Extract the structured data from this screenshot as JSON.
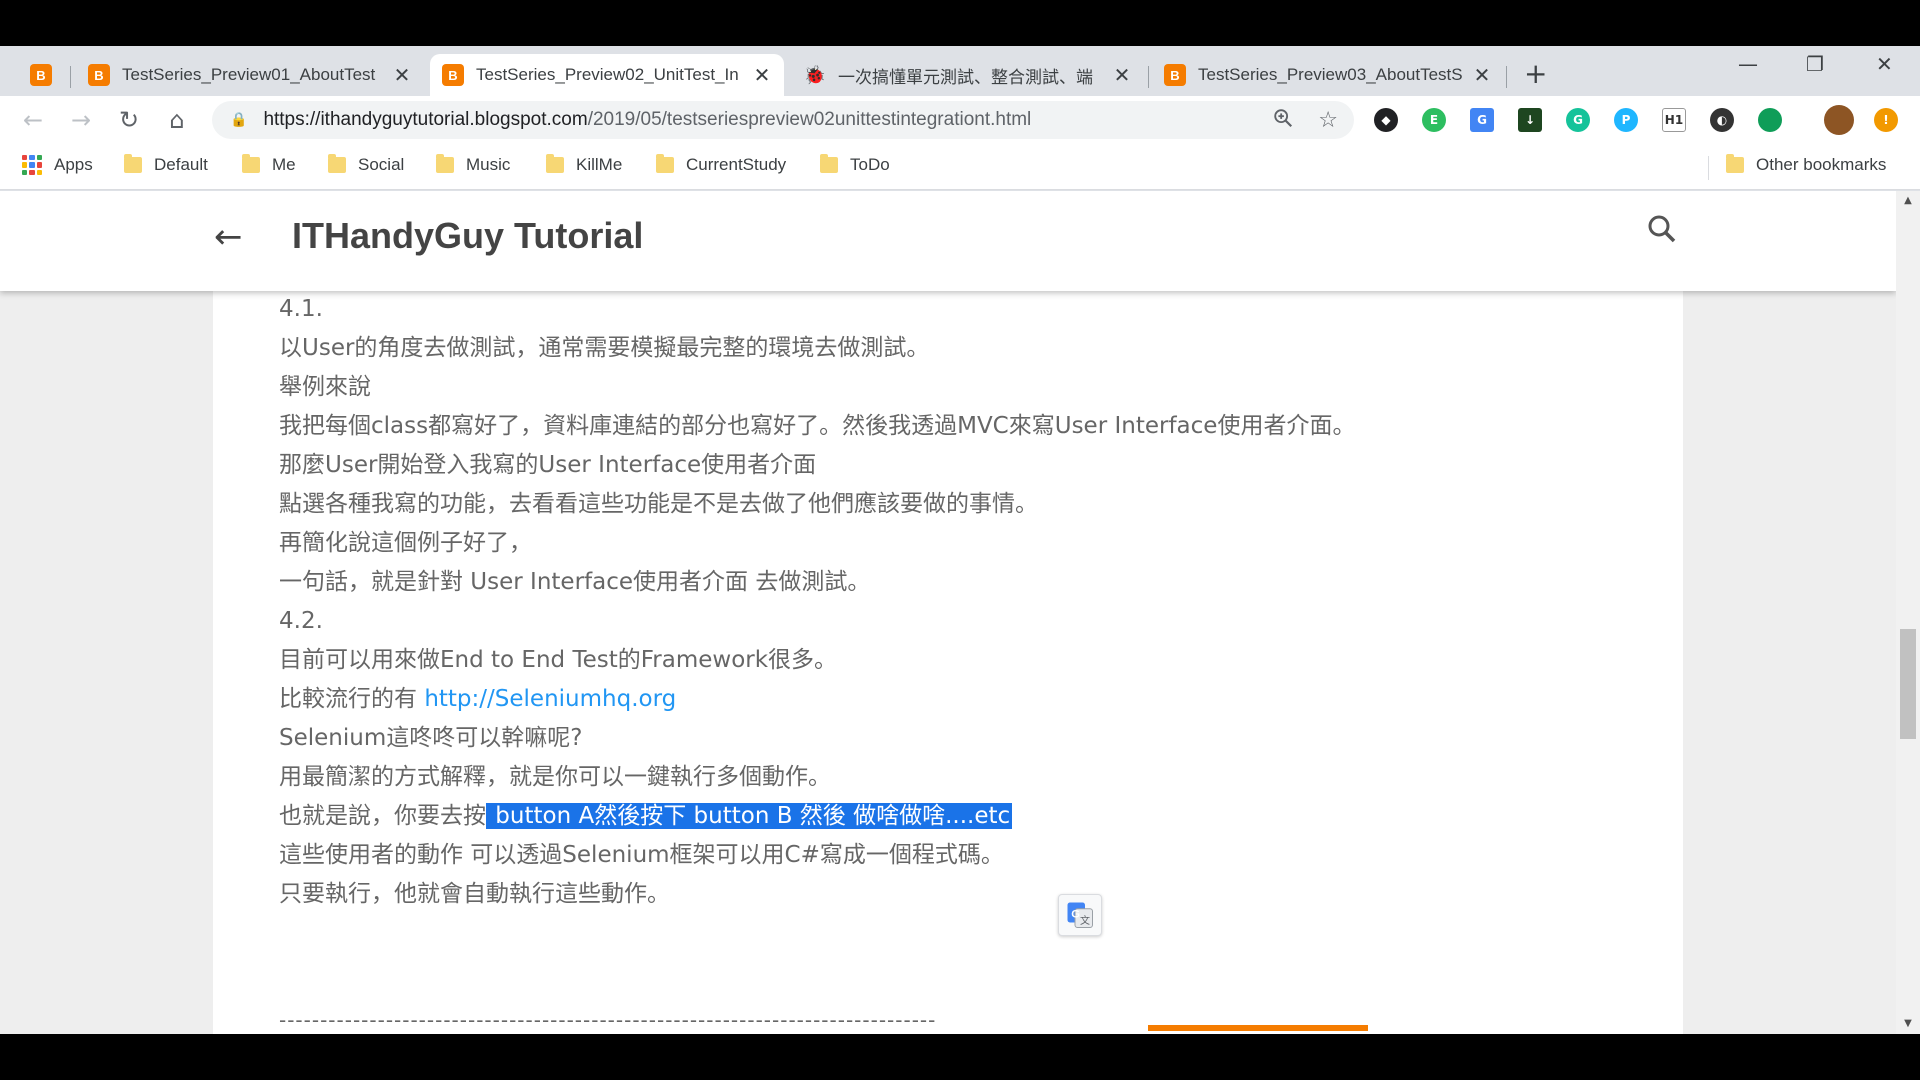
{
  "tabs": [
    {
      "title": "TestSeries_Preview01_AboutTest",
      "favicon": "blogger-icon",
      "active": false
    },
    {
      "title": "TestSeries_Preview02_UnitTest_In",
      "favicon": "blogger-icon",
      "active": true
    },
    {
      "title": "一次搞懂單元測試、整合測試、端",
      "favicon": "bug-icon",
      "active": false
    },
    {
      "title": "TestSeries_Preview03_AboutTestS",
      "favicon": "blogger-icon",
      "active": false
    }
  ],
  "address_bar": {
    "host": "https://ithandyguytutorial.blogspot.com",
    "path": "/2019/05/testseriespreview02unittestintegrationt.html"
  },
  "bookmarks": {
    "apps": "Apps",
    "items": [
      "Default",
      "Me",
      "Social",
      "Music",
      "KillMe",
      "CurrentStudy",
      "ToDo"
    ],
    "other": "Other bookmarks"
  },
  "blog": {
    "title": "ITHandyGuy Tutorial"
  },
  "content": {
    "l01": "4.1.",
    "l02": "以User的角度去做測試，通常需要模擬最完整的環境去做測試。",
    "l03": "舉例來說",
    "l04": "我把每個class都寫好了，資料庫連結的部分也寫好了。然後我透過MVC來寫User Interface使用者介面。",
    "l05": "那麼User開始登入我寫的User Interface使用者介面",
    "l06": "點選各種我寫的功能，去看看這些功能是不是去做了他們應該要做的事情。",
    "l07": "再簡化說這個例子好了，",
    "l08": "一句話，就是針對 User Interface使用者介面 去做測試。",
    "l09": "4.2.",
    "l10": "目前可以用來做End to End Test的Framework很多。",
    "l11_prefix": "比較流行的有 ",
    "l11_link": "http://Seleniumhq.org",
    "l12": "Selenium這咚咚可以幹嘛呢?",
    "l13": "用最簡潔的方式解釋，就是你可以一鍵執行多個動作。",
    "l14_prefix": "也就是說，你要去按",
    "l14_selected": " button A然後按下 button B 然後 做啥做啥....etc",
    "l15": "這些使用者的動作 可以透過Selenium框架可以用C#寫成一個程式碼。",
    "l16": "只要執行，他就會自動執行這些動作。",
    "divider": "--------------------------------------------------------------------------------"
  },
  "colors": {
    "selection": "#1a73e8",
    "link": "#2196f3",
    "blogger_orange": "#f57c00"
  }
}
